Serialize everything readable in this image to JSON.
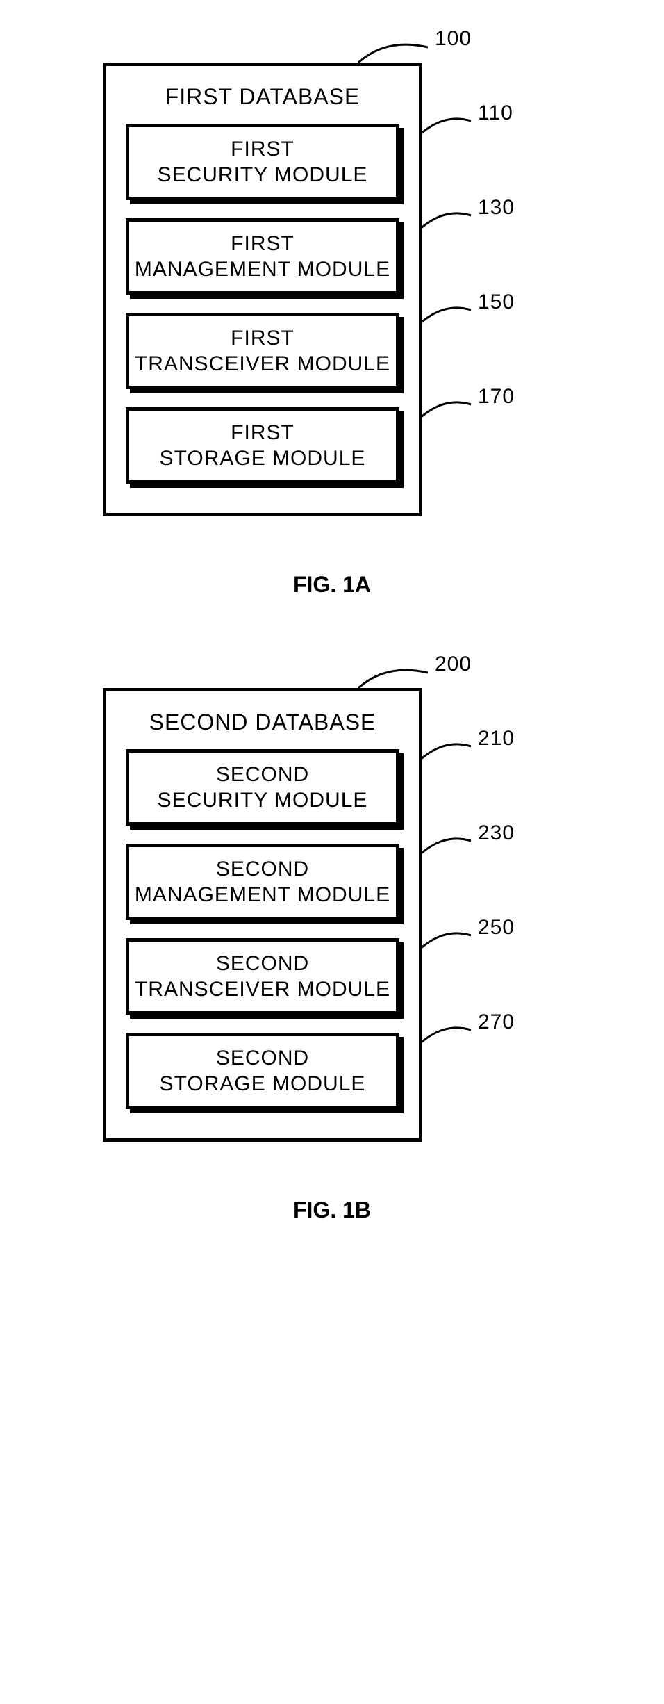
{
  "figures": [
    {
      "caption": "FIG. 1A",
      "outer": {
        "title": "FIRST DATABASE",
        "ref": "100"
      },
      "modules": [
        {
          "line1": "FIRST",
          "line2": "SECURITY MODULE",
          "ref": "110"
        },
        {
          "line1": "FIRST",
          "line2": "MANAGEMENT MODULE",
          "ref": "130"
        },
        {
          "line1": "FIRST",
          "line2": "TRANSCEIVER MODULE",
          "ref": "150"
        },
        {
          "line1": "FIRST",
          "line2": "STORAGE MODULE",
          "ref": "170"
        }
      ]
    },
    {
      "caption": "FIG. 1B",
      "outer": {
        "title": "SECOND DATABASE",
        "ref": "200"
      },
      "modules": [
        {
          "line1": "SECOND",
          "line2": "SECURITY MODULE",
          "ref": "210"
        },
        {
          "line1": "SECOND",
          "line2": "MANAGEMENT MODULE",
          "ref": "230"
        },
        {
          "line1": "SECOND",
          "line2": "TRANSCEIVER MODULE",
          "ref": "250"
        },
        {
          "line1": "SECOND",
          "line2": "STORAGE MODULE",
          "ref": "270"
        }
      ]
    }
  ]
}
